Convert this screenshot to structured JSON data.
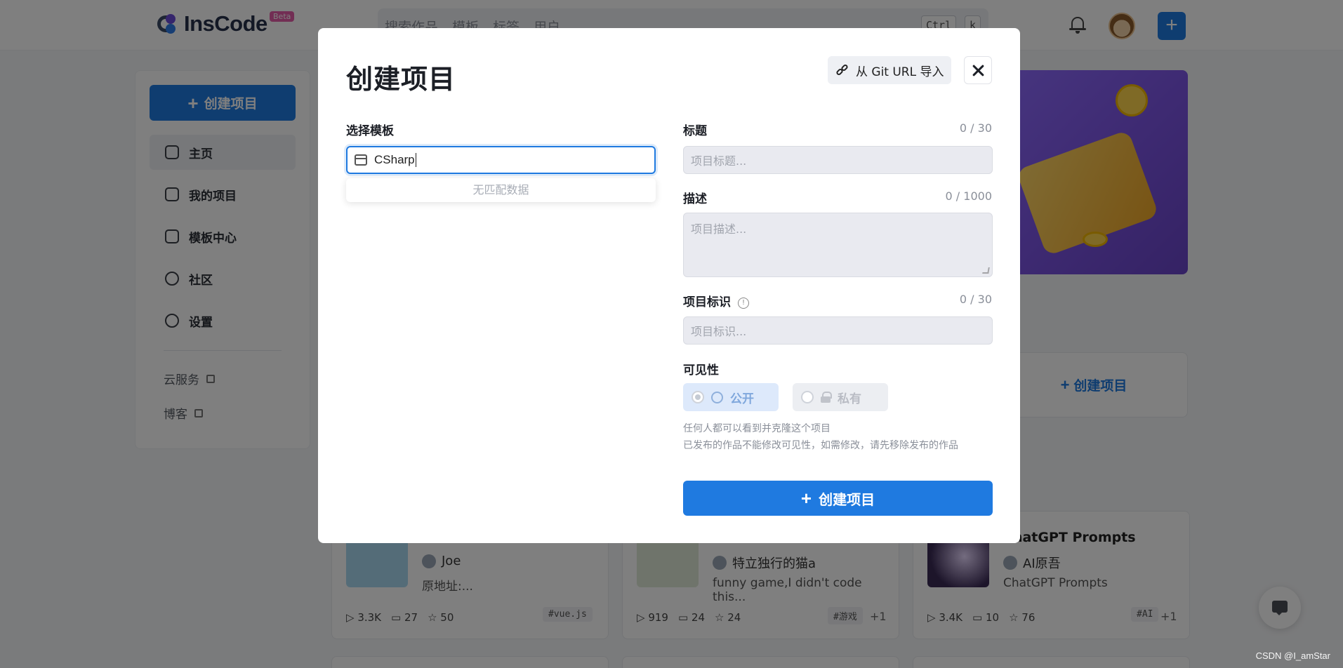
{
  "topbar": {
    "logo_text": "InsCode",
    "beta_badge": "Beta",
    "search_tabs": [
      "搜索作品",
      "模板",
      "标签",
      "用户"
    ],
    "shortcut_keys": [
      "Ctrl",
      "k"
    ],
    "new_button_label": "+"
  },
  "sidebar": {
    "create_button": "创建项目",
    "items": [
      {
        "label": "主页",
        "icon": "home-icon"
      },
      {
        "label": "我的项目",
        "icon": "layers-icon"
      },
      {
        "label": "模板中心",
        "icon": "template-icon"
      },
      {
        "label": "社区",
        "icon": "smile-icon"
      },
      {
        "label": "设置",
        "icon": "settings-icon"
      }
    ],
    "links": [
      "云服务",
      "博客"
    ]
  },
  "right_panel": {
    "create_button": "创建项目"
  },
  "cards": [
    {
      "title": "",
      "author": "Joe",
      "desc": "原地址:...",
      "plays": "3.3K",
      "comments": "27",
      "stars": "50",
      "tag": "#vue.js",
      "more": ""
    },
    {
      "title": "",
      "author": "特立独行的猫a",
      "desc": "funny game,I didn't code this...",
      "plays": "919",
      "comments": "24",
      "stars": "24",
      "tag": "#游戏",
      "more": "+1"
    },
    {
      "title": "ChatGPT Prompts",
      "author": "AI原吾",
      "desc": "ChatGPT Prompts",
      "plays": "3.4K",
      "comments": "10",
      "stars": "76",
      "tag": "#AI",
      "more": "+1"
    }
  ],
  "modal": {
    "title": "创建项目",
    "git_import_label": "从 Git URL 导入",
    "template": {
      "label": "选择模板",
      "value": "CSharp",
      "no_match": "无匹配数据"
    },
    "title_field": {
      "label": "标题",
      "count": "0 / 30",
      "placeholder": "项目标题..."
    },
    "desc_field": {
      "label": "描述",
      "count": "0 / 1000",
      "placeholder": "项目描述..."
    },
    "ident_field": {
      "label": "项目标识",
      "count": "0 / 30",
      "placeholder": "项目标识...",
      "info_icon": "!"
    },
    "visibility": {
      "label": "可见性",
      "public_label": "公开",
      "private_label": "私有",
      "hint_1": "任何人都可以看到并克隆这个项目",
      "hint_2": "已发布的作品不能修改可见性，如需修改，请先移除发布的作品"
    },
    "submit_label": "创建项目"
  },
  "watermark": "CSDN @I_amStar",
  "colors": {
    "accent": "#1f7ae0",
    "overlay": "rgba(0,0,0,0.5)"
  }
}
